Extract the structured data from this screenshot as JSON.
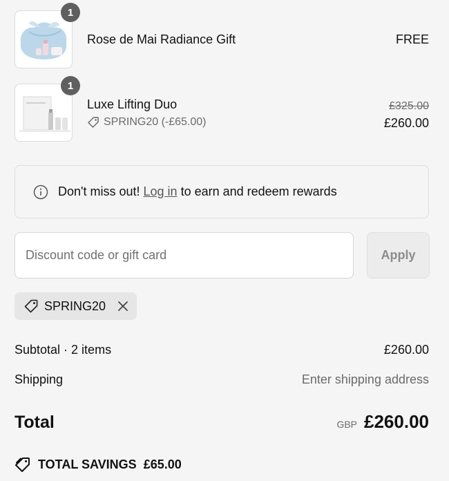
{
  "items": [
    {
      "name": "Rose de Mai Radiance Gift",
      "quantity": "1",
      "price": "FREE"
    },
    {
      "name": "Luxe Lifting Duo",
      "quantity": "1",
      "original_price": "£325.00",
      "price": "£260.00",
      "discount_label": "SPRING20 (-£65.00)"
    }
  ],
  "rewards": {
    "text_before": "Don't miss out!",
    "link_text": "Log in",
    "text_after": "to earn and redeem rewards"
  },
  "discount": {
    "placeholder": "Discount code or gift card",
    "apply_label": "Apply",
    "applied_code": "SPRING20"
  },
  "summary": {
    "subtotal_label": "Subtotal · 2 items",
    "subtotal_value": "£260.00",
    "shipping_label": "Shipping",
    "shipping_value": "Enter shipping address",
    "total_label": "Total",
    "currency": "GBP",
    "total_value": "£260.00",
    "savings_label": "TOTAL SAVINGS",
    "savings_value": "£65.00"
  },
  "icons": {
    "info": "info-icon",
    "tag": "tag-icon",
    "close": "close-icon",
    "savings": "savings-tag-icon"
  },
  "colors": {
    "background": "#f5f5f5",
    "badge": "#5f5f5f",
    "muted_text": "#6b6b6b"
  }
}
